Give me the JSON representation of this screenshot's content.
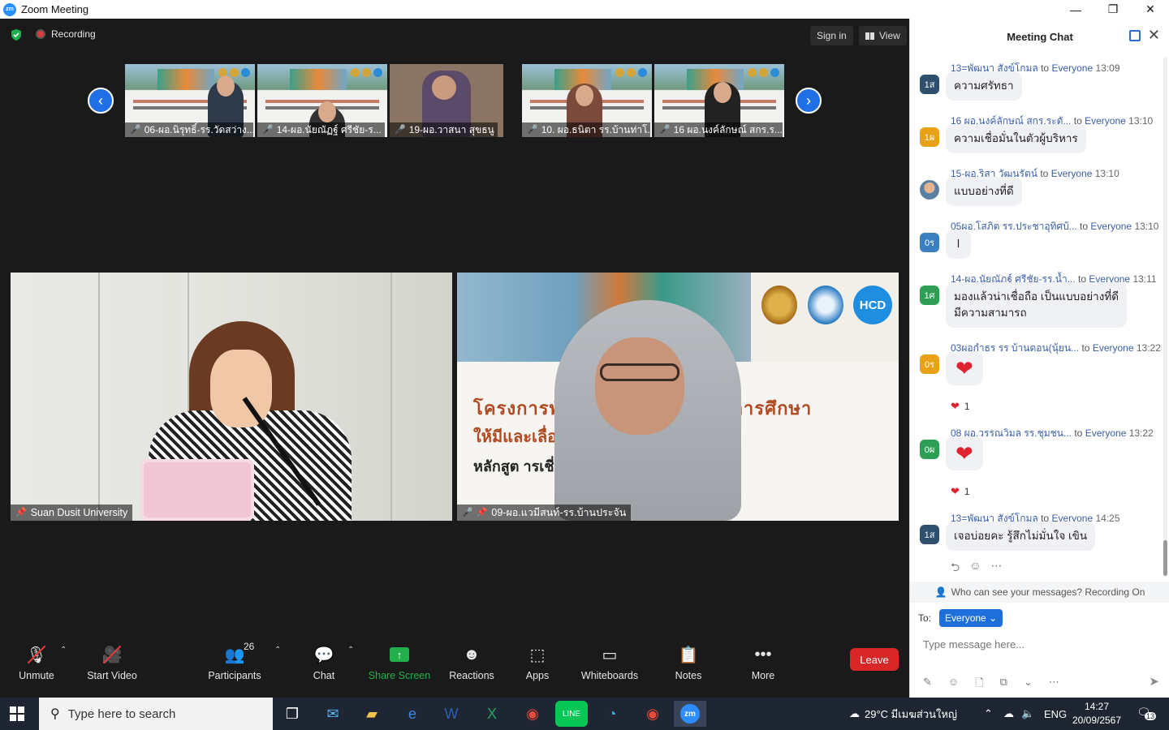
{
  "window": {
    "app_logo": "zm",
    "title": "Zoom Meeting",
    "controls": [
      "—",
      "❐",
      "✕"
    ]
  },
  "topbar": {
    "recording_label": "Recording",
    "signin_label": "Sign in",
    "view_label": "View"
  },
  "filmstrip": {
    "thumbnails": [
      {
        "name": "06-ผอ.นิรุทธิ์-รร.วัดสว่าง..."
      },
      {
        "name": "14-ผอ.นัยณัฏฐ์ ศรีชัย-ร..."
      },
      {
        "name": "19-ผอ.วาสนา สุขธนู"
      },
      {
        "name": "10. ผอ.ธนิตา รร.บ้านท่าโ..."
      },
      {
        "name": "16 ผอ.นงค์ลักษณ์ สกร.ร..."
      }
    ]
  },
  "videos": {
    "left_name": "Suan Dusit University",
    "right_name": "09-ผอ.แวมีสนท์-รร.บ้านประจัน",
    "right_slide_line1": "โครงการพัฒ          รูและบุคลากรทางการศึกษา",
    "right_slide_line2": "               ให้มีและเลื่อนเป็นวิทยฐานะ",
    "right_slide_line3": "หลักสูต                 ารเชี่ยวชาญ ระยะที่ 146",
    "logo_text": "HCD"
  },
  "toolbar": {
    "unmute": "Unmute",
    "start_video": "Start Video",
    "participants": "Participants",
    "participants_count": "26",
    "chat": "Chat",
    "share_screen": "Share Screen",
    "reactions": "Reactions",
    "apps": "Apps",
    "whiteboards": "Whiteboards",
    "notes": "Notes",
    "more": "More",
    "leave": "Leave"
  },
  "chat": {
    "title": "Meeting Chat",
    "to_word": "to",
    "messages": [
      {
        "sender": "13=พัฒนา สังข์โกมล",
        "to": "Everyone",
        "time": "13:09",
        "avatar": "1ส",
        "avatar_color": "#2f4f6f",
        "text": "ความศรัทธา"
      },
      {
        "sender": "16 ผอ.นงค์ลักษณ์ สกร.ระดั...",
        "to": "Everyone",
        "time": "13:10",
        "avatar": "1ผ",
        "avatar_color": "#e8a116",
        "text": "ความเชื่อมั่นในตัวผู้บริหาร"
      },
      {
        "sender": "15-ผอ.ริสา วัฒนรัตน์",
        "to": "Everyone",
        "time": "13:10",
        "avatar": "",
        "avatar_color": "#9bb7c9",
        "text": "แบบอย่างที่ดี"
      },
      {
        "sender": "05ผอ.โสภิต  รร.ประชาอุทิศบ้...",
        "to": "Everyone",
        "time": "13:10",
        "avatar": "0ร",
        "avatar_color": "#3a7fc0",
        "text": "l"
      },
      {
        "sender": "14-ผอ.นัยณัฏฐ์ ศรีชัย-รร.น้ำ...",
        "to": "Everyone",
        "time": "13:11",
        "avatar": "1ศ",
        "avatar_color": "#2e9e55",
        "text": "มองแล้วน่าเชื่อถือ เป็นแบบอย่างที่ดี",
        "text2": "มีความสามารถ"
      },
      {
        "sender": "03ผอกำธร รร บ้านดอน(นุ้ยน...",
        "to": "Everyone",
        "time": "13:22",
        "avatar": "0ร",
        "avatar_color": "#e8a116",
        "text": "❤",
        "reaction": "1"
      },
      {
        "sender": "08 ผอ.วรรณวิมล    รร.ชุมชน...",
        "to": "Everyone",
        "time": "13:22",
        "avatar": "0ผ",
        "avatar_color": "#2e9e55",
        "text": "❤",
        "reaction": "1"
      },
      {
        "sender": "13=พัฒนา สังข์โกมล",
        "to": "Everyone",
        "time": "14:25",
        "avatar": "1ส",
        "avatar_color": "#2f4f6f",
        "text": "เจอบ่อยคะ  รู้สึกไม่มั่นใจ  เขิน"
      }
    ],
    "visibility_note": "Who can see your messages? Recording On",
    "to_label": "To:",
    "recipient": "Everyone",
    "input_placeholder": "Type message here..."
  },
  "taskbar": {
    "search_placeholder": "Type here to search",
    "weather": "29°C  มีเมฆส่วนใหญ่",
    "language": "ENG",
    "time": "14:27",
    "date": "20/09/2567",
    "notifications": "13"
  }
}
